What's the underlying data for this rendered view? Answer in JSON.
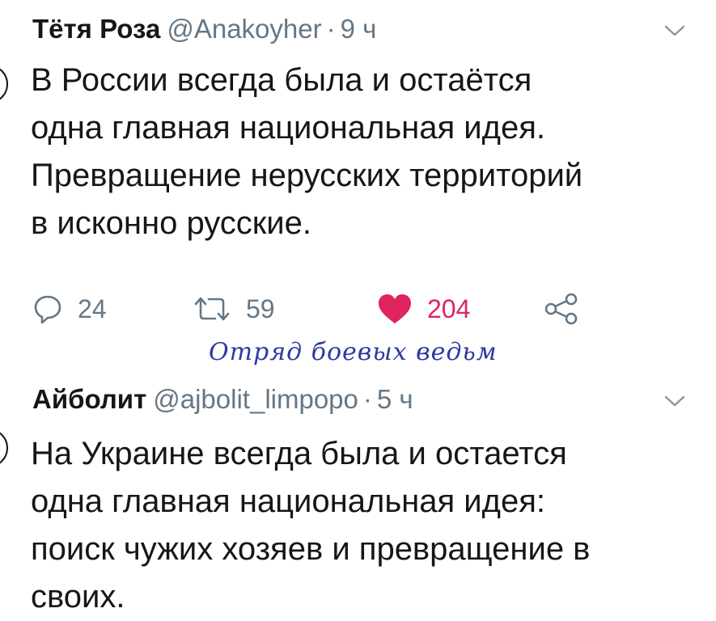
{
  "tweets": [
    {
      "name": "Тётя Роза",
      "handle": "@Anakoyher",
      "separator": "·",
      "time": "9 ч",
      "text_lines": [
        "В России всегда была и остаётся",
        "одна главная национальная идея.",
        "Превращение нерусских территорий",
        "в исконно русские."
      ],
      "actions": {
        "replies": "24",
        "retweets": "59",
        "likes": "204"
      }
    },
    {
      "name": "Айболит",
      "handle": "@ajbolit_limpopo",
      "separator": "·",
      "time": "5 ч",
      "text_lines": [
        "На Украине всегда была и остается",
        "одна главная национальная идея:",
        "поиск чужих хозяев и превращение в",
        "своих."
      ]
    }
  ],
  "watermark": "Отряд боевых ведьм",
  "colors": {
    "text": "#14171a",
    "secondary": "#657786",
    "like": "#e0245e",
    "watermark": "#2d3aa0"
  },
  "icons": [
    "chevron-down-icon",
    "reply-icon",
    "retweet-icon",
    "heart-icon",
    "share-icon"
  ]
}
